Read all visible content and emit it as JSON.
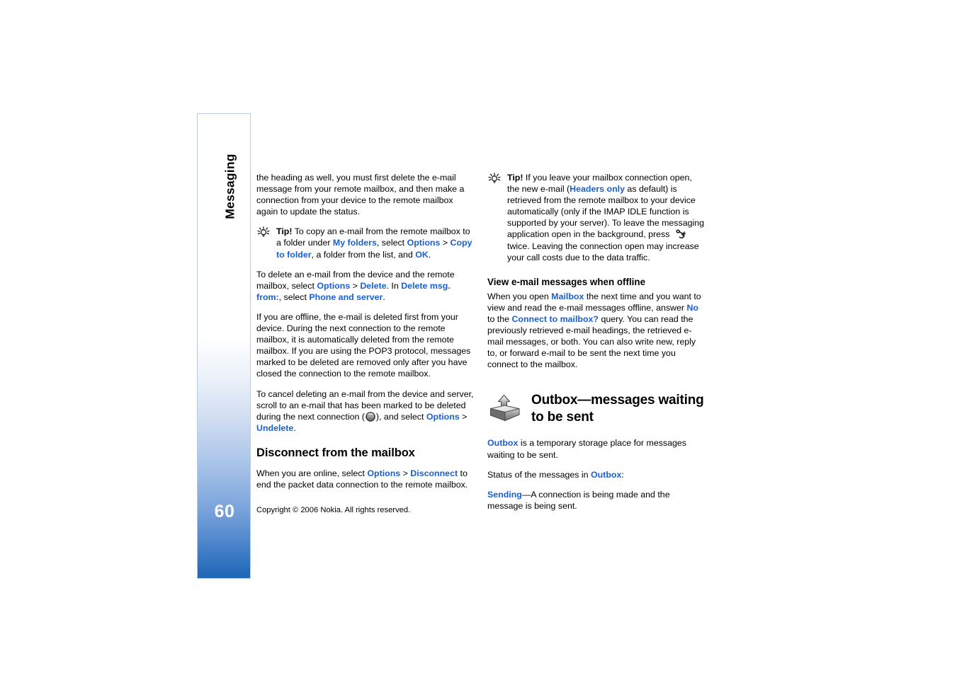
{
  "document": {
    "title": "Nokia User Guide Page",
    "page_number": "60",
    "chapter_tab_label": "Messaging",
    "copyright": "Copyright © 2006 Nokia. All rights reserved."
  },
  "colors": {
    "link_blue": "#1a5fd1",
    "tab_gradient_bottom": "#2269b8",
    "tab_border": "#b9cbe0",
    "text": "#000000"
  },
  "left_column": {
    "para_1": {
      "part_1": "the heading as well, you must first delete the e-mail message from your remote mailbox, and then make a connection from your device to the remote mailbox again to update the status."
    },
    "tip_1": {
      "icon": "lightbulb-tip-icon",
      "label": "Tip!",
      "part_1": " To copy an e-mail from the remote mailbox to a folder under ",
      "link_1": "My folders",
      "part_2": ", select ",
      "link_2": "Options",
      "sep_1": " > ",
      "link_3": "Copy to folder",
      "part_3": ", a folder from the list, and ",
      "link_4": "OK",
      "part_4": "."
    },
    "para_2": {
      "part_1": "To delete an e-mail from the device and the remote mailbox, select ",
      "link_1": "Options",
      "sep_1": " > ",
      "link_2": "Delete",
      "part_2": ". In ",
      "link_3": "Delete msg. from:",
      "part_3": ", select ",
      "link_4": "Phone and server",
      "part_4": "."
    },
    "para_3": {
      "part_1": "If you are offline, the e-mail is deleted first from your device. During the next connection to the remote mailbox, it is automatically deleted from the remote mailbox. If you are using the POP3 protocol, messages marked to be deleted are removed only after you have closed the connection to the remote mailbox."
    },
    "para_4": {
      "part_1": "To cancel deleting an e-mail from the device and server, scroll to an e-mail that has been marked to be deleted during the next connection (",
      "icon": "delete-marker-icon",
      "part_2": "), and select ",
      "link_1": "Options",
      "sep_1": " > ",
      "link_2": "Undelete",
      "part_3": "."
    },
    "heading_1": "Disconnect from the mailbox",
    "para_5": {
      "part_1": "When you are online, select ",
      "link_1": "Options",
      "sep_1": " > ",
      "link_2": "Disconnect",
      "part_2": " to end the packet data connection to the remote mailbox."
    }
  },
  "right_column": {
    "tip_1": {
      "icon": "lightbulb-tip-icon",
      "label": "Tip!",
      "part_1": " If you leave your mailbox connection open, the new e-mail (",
      "link_1": "Headers only",
      "part_2": " as default) is retrieved from the remote mailbox to your device automatically (only if the IMAP IDLE function is supported by your server). To leave the messaging application open in the background, press ",
      "icon_inline": "menu-key-icon",
      "part_3": " twice. Leaving the connection open may increase your call costs due to the data traffic."
    },
    "heading_1": "View e-mail messages when offline",
    "para_1": {
      "part_1": "When you open ",
      "link_1": "Mailbox",
      "part_2": " the next time and you want to view and read the e-mail messages offline, answer ",
      "link_2": "No",
      "part_3": " to the ",
      "link_3": "Connect to mailbox?",
      "part_4": " query. You can read the previously retrieved e-mail headings, the retrieved e-mail messages, or both. You can also write new, reply to, or forward e-mail to be sent the next time you connect to the mailbox."
    },
    "chapter_heading": {
      "icon": "outbox-tray-icon",
      "line_1": "Outbox—messages waiting",
      "line_2": "to be sent"
    },
    "para_2": {
      "link_1": "Outbox",
      "part_1": " is a temporary storage place for messages waiting to be sent."
    },
    "para_3": {
      "part_1": "Status of the messages in ",
      "link_1": "Outbox",
      "part_2": ":"
    },
    "para_4": {
      "link_1": "Sending",
      "part_1": "—A connection is being made and the message is being sent."
    }
  }
}
